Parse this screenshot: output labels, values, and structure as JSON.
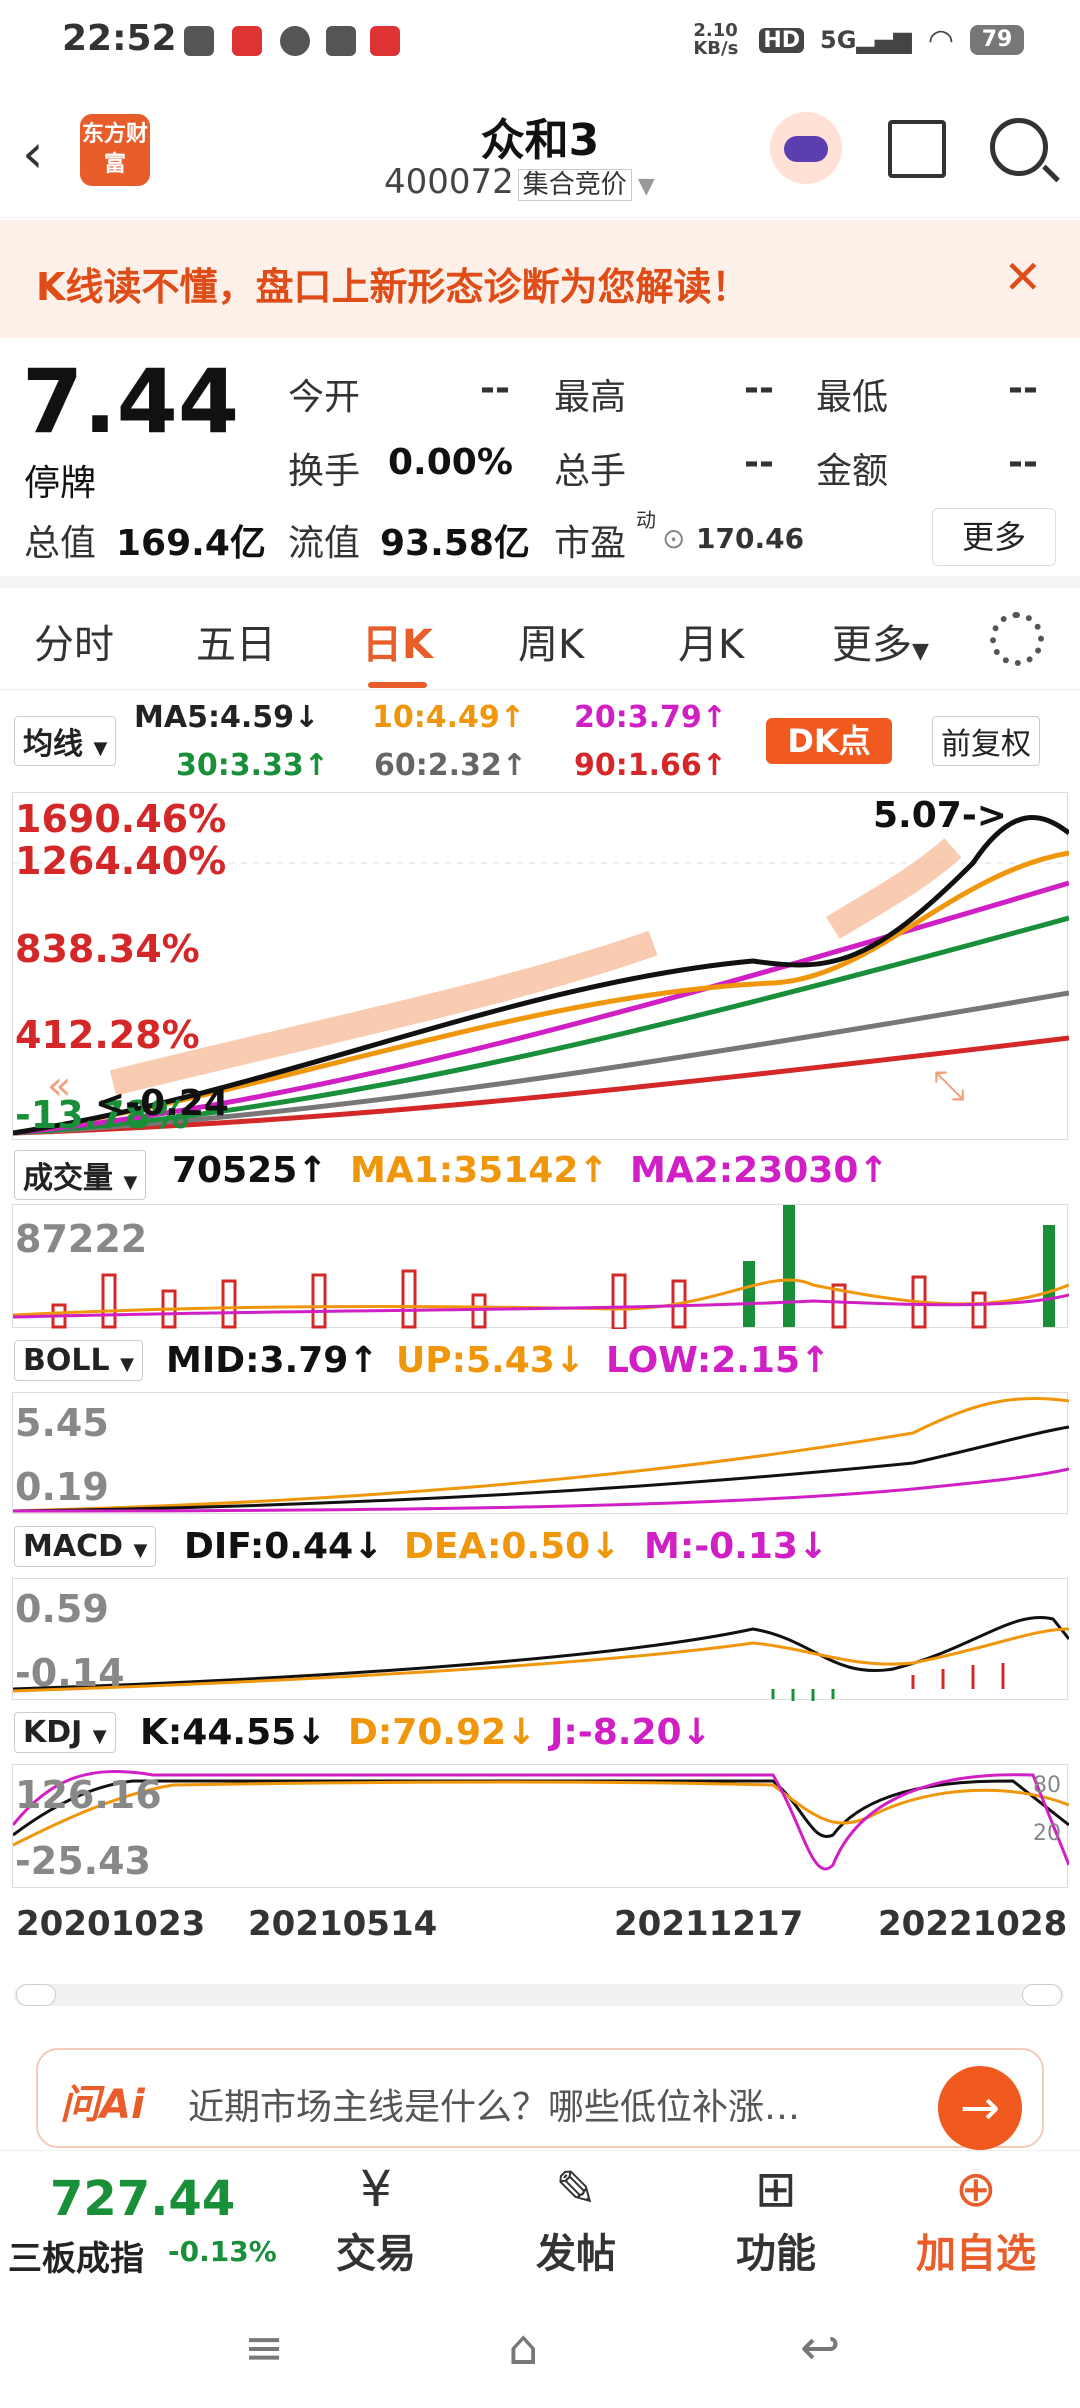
{
  "status": {
    "time": "22:52",
    "speed": "2.10 KB/s",
    "battery": "79"
  },
  "header": {
    "title": "众和3",
    "code": "400072",
    "market_tag": "集合竞价",
    "logo": "东方财富"
  },
  "banner": {
    "text": "K线读不懂，盘口上新形态诊断为您解读！"
  },
  "quote": {
    "price": "7.44",
    "status": "停牌",
    "open_label": "今开",
    "open": "--",
    "high_label": "最高",
    "high": "--",
    "low_label": "最低",
    "low": "--",
    "turnover_label": "换手",
    "turnover": "0.00%",
    "volume_label": "总手",
    "volume": "--",
    "amount_label": "金额",
    "amount": "--",
    "mktcap_label": "总值",
    "mktcap": "169.4亿",
    "float_label": "流值",
    "float": "93.58亿",
    "pe_label": "市盈",
    "pe_sup": "动",
    "pe": "170.46",
    "more": "更多"
  },
  "tabs": [
    "分时",
    "五日",
    "日K",
    "周K",
    "月K",
    "更多"
  ],
  "ma": {
    "select": "均线",
    "ma5": "MA5:4.59↓",
    "ma10": "10:4.49↑",
    "ma20": "20:3.79↑",
    "ma30": "30:3.33↑",
    "ma60": "60:2.32↑",
    "ma90": "90:1.66↑",
    "dk": "DK点",
    "adjust": "前复权"
  },
  "main_chart": {
    "ylabels": [
      "1690.46%",
      "1264.40%",
      "838.34%",
      "412.28%",
      "-13.78%"
    ],
    "max_label": "5.07->",
    "min_label": "<-0.24"
  },
  "volume": {
    "select": "成交量",
    "val": "70525↑",
    "ma1": "MA1:35142↑",
    "ma2": "MA2:23030↑",
    "top": "87222"
  },
  "boll": {
    "select": "BOLL",
    "mid": "MID:3.79↑",
    "up": "UP:5.43↓",
    "low": "LOW:2.15↑",
    "top": "5.45",
    "bottom": "0.19"
  },
  "macd": {
    "select": "MACD",
    "dif": "DIF:0.44↓",
    "dea": "DEA:0.50↓",
    "m": "M:-0.13↓",
    "top": "0.59",
    "bottom": "-0.14"
  },
  "kdj": {
    "select": "KDJ",
    "k": "K:44.55↓",
    "d": "D:70.92↓",
    "j": "J:-8.20↓",
    "top": "126.16",
    "bottom": "-25.43",
    "r80": "80",
    "r20": "20"
  },
  "dates": [
    "20201023",
    "20210514",
    "20211217",
    "20221028"
  ],
  "ai": {
    "logo": "问Ai",
    "question": "近期市场主线是什么？哪些低位补涨…"
  },
  "bottom": {
    "index_value": "727.44",
    "index_name": "三板成指",
    "index_pct": "-0.13%",
    "trade": "交易",
    "post": "发帖",
    "func": "功能",
    "add": "加自选"
  },
  "colors": {
    "accent": "#e85d2a",
    "red": "#d42828",
    "green": "#1a8f3a",
    "orange": "#f0960a",
    "magenta": "#d01fc4"
  }
}
